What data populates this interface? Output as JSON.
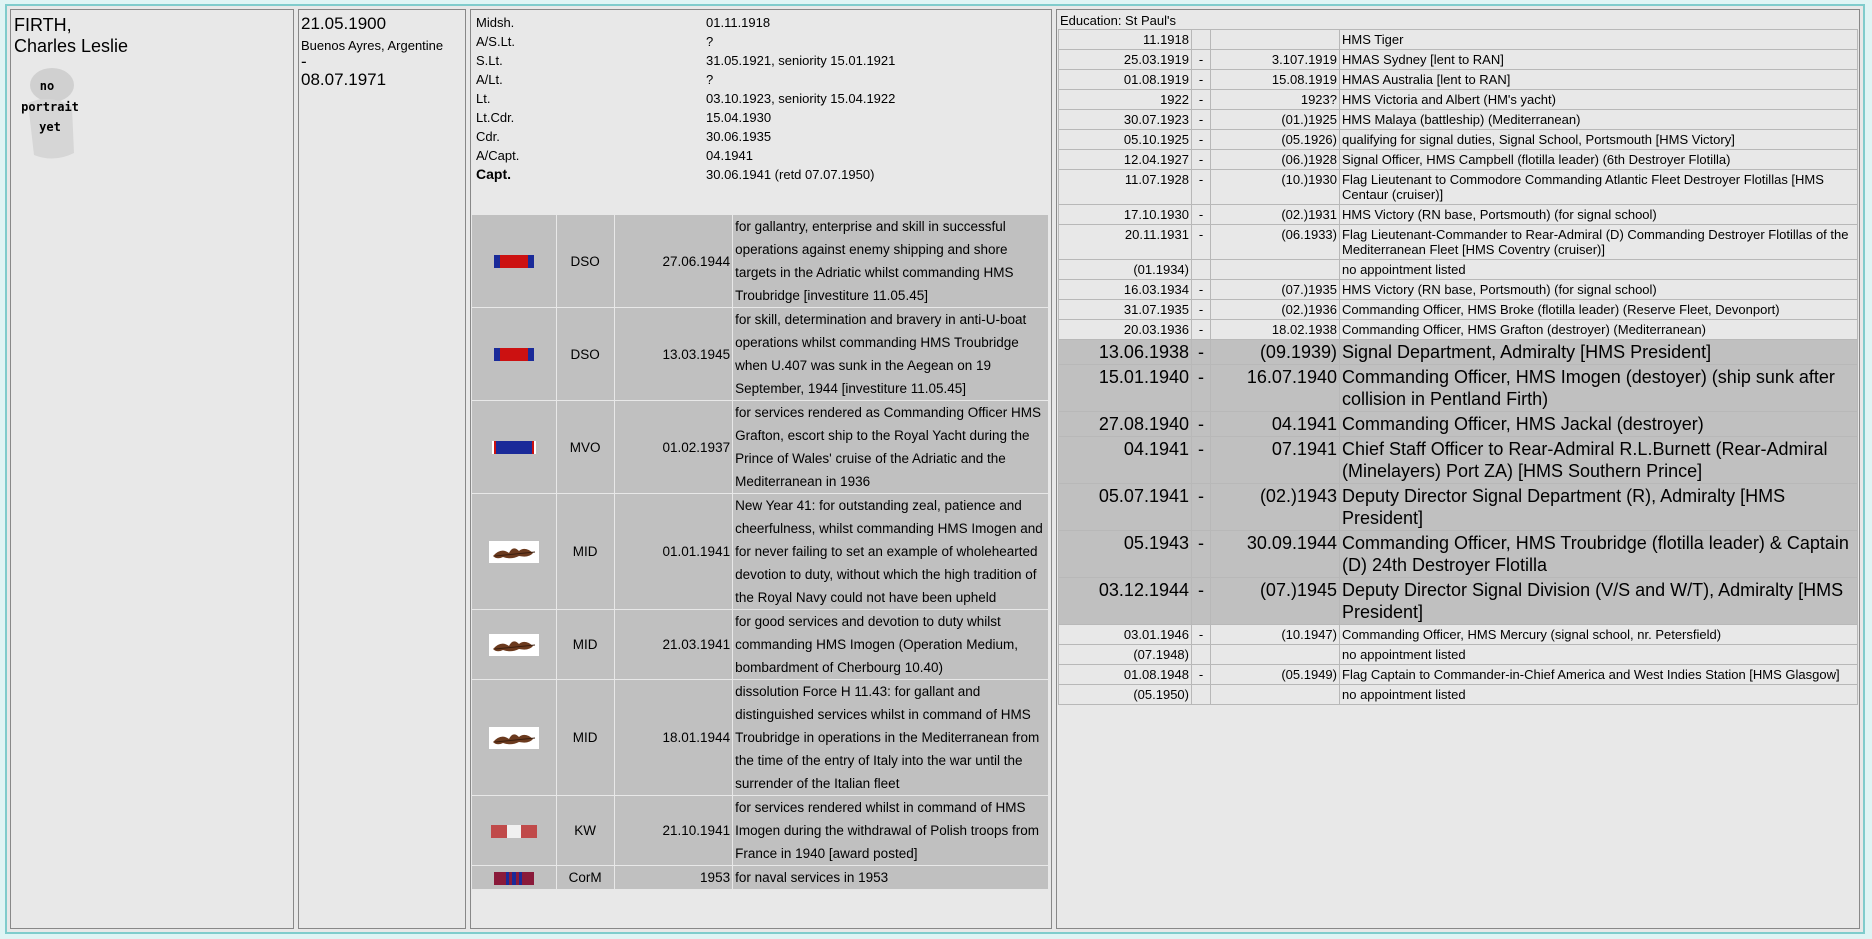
{
  "person": {
    "surname": "FIRTH,",
    "forenames": "Charles Leslie",
    "portrait_text": [
      "no",
      "portrait",
      "yet"
    ],
    "born": "21.05.1900",
    "birthplace": "Buenos Ayres, Argentine",
    "dash": "-",
    "died": "08.07.1971"
  },
  "ranks": [
    {
      "rank": "Midsh.",
      "date": "01.11.1918"
    },
    {
      "rank": "A/S.Lt.",
      "date": "?"
    },
    {
      "rank": "S.Lt.",
      "date": "31.05.1921, seniority 15.01.1921"
    },
    {
      "rank": "A/Lt.",
      "date": "?"
    },
    {
      "rank": "Lt.",
      "date": "03.10.1923, seniority 15.04.1922"
    },
    {
      "rank": "Lt.Cdr.",
      "date": "15.04.1930"
    },
    {
      "rank": "Cdr.",
      "date": "30.06.1935"
    },
    {
      "rank": "A/Capt.",
      "date": "04.1941"
    },
    {
      "rank": "Capt.",
      "date": "30.06.1941 (retd 07.07.1950)"
    }
  ],
  "awards": [
    {
      "ribbon": "dso-ribbon",
      "code": "DSO",
      "date": "27.06.1944",
      "citation": "for gallantry, enterprise and skill in successful operations against enemy shipping and shore targets in the Adriatic whilst commanding HMS Troubridge [investiture 11.05.45]"
    },
    {
      "ribbon": "dso-ribbon",
      "code": "DSO",
      "date": "13.03.1945",
      "citation": "for skill, determination and bravery in anti-U-boat operations whilst commanding HMS Troubridge when U.407 was sunk in the Aegean on 19 September, 1944 [investiture 11.05.45]"
    },
    {
      "ribbon": "mvo-ribbon",
      "code": "MVO",
      "date": "01.02.1937",
      "citation": "for services rendered as Commanding Officer HMS Grafton, escort ship to the Royal Yacht during the Prince of Wales' cruise of the Adriatic and the Mediterranean in 1936"
    },
    {
      "ribbon": "oak-leaf",
      "code": "MID",
      "date": "01.01.1941",
      "citation": "New Year 41: for outstanding zeal, patience and cheerfulness, whilst commanding HMS Imogen and for never failing to set an example of wholehearted devotion to duty, without which the high tradition of the Royal Navy could not have been upheld"
    },
    {
      "ribbon": "oak-leaf",
      "code": "MID",
      "date": "21.03.1941",
      "citation": "for good services and devotion to duty whilst commanding HMS Imogen (Operation Medium, bombardment of Cherbourg 10.40)"
    },
    {
      "ribbon": "oak-leaf",
      "code": "MID",
      "date": "18.01.1944",
      "citation": "dissolution Force H 11.43: for gallant and distinguished services whilst in command of HMS Troubridge in operations in the Mediterranean from the time of the entry of Italy into the war until the surrender of the Italian fleet"
    },
    {
      "ribbon": "kw-ribbon",
      "code": "KW",
      "date": "21.10.1941",
      "citation": "for services rendered whilst in command of HMS Imogen during the withdrawal of Polish troops from France in 1940 [award posted]"
    },
    {
      "ribbon": "corm-ribbon",
      "code": "CorM",
      "date": "1953",
      "citation": "for naval services in 1953"
    }
  ],
  "education": "Education: St Paul's",
  "career": [
    {
      "from": "11.1918",
      "dash": "",
      "to": "",
      "appt": "HMS Tiger",
      "hl": false
    },
    {
      "from": "25.03.1919",
      "dash": "-",
      "to": "3.107.1919",
      "appt": "HMAS Sydney [lent to RAN]",
      "hl": false
    },
    {
      "from": "01.08.1919",
      "dash": "-",
      "to": "15.08.1919",
      "appt": "HMAS Australia [lent to RAN]",
      "hl": false
    },
    {
      "from": "1922",
      "dash": "-",
      "to": "1923?",
      "appt": "HMS Victoria and Albert (HM's yacht)",
      "hl": false
    },
    {
      "from": "30.07.1923",
      "dash": "-",
      "to": "(01.)1925",
      "appt": "HMS Malaya (battleship) (Mediterranean)",
      "hl": false
    },
    {
      "from": "05.10.1925",
      "dash": "-",
      "to": "(05.1926)",
      "appt": "qualifying for signal duties, Signal School, Portsmouth [HMS Victory]",
      "hl": false
    },
    {
      "from": "12.04.1927",
      "dash": "-",
      "to": "(06.)1928",
      "appt": "Signal Officer, HMS Campbell (flotilla leader) (6th Destroyer Flotilla)",
      "hl": false
    },
    {
      "from": "11.07.1928",
      "dash": "-",
      "to": "(10.)1930",
      "appt": "Flag Lieutenant to Commodore Commanding Atlantic Fleet Destroyer Flotillas [HMS Centaur (cruiser)]",
      "hl": false
    },
    {
      "from": "17.10.1930",
      "dash": "-",
      "to": "(02.)1931",
      "appt": "HMS Victory (RN base, Portsmouth) (for signal school)",
      "hl": false
    },
    {
      "from": "20.11.1931",
      "dash": "-",
      "to": "(06.1933)",
      "appt": "Flag Lieutenant-Commander to Rear-Admiral (D) Commanding Destroyer Flotillas of the Mediterranean Fleet [HMS Coventry (cruiser)]",
      "hl": false
    },
    {
      "from": "(01.1934)",
      "dash": "",
      "to": "",
      "appt": "no appointment listed",
      "hl": false
    },
    {
      "from": "16.03.1934",
      "dash": "-",
      "to": "(07.)1935",
      "appt": "HMS Victory (RN base, Portsmouth) (for signal school)",
      "hl": false
    },
    {
      "from": "31.07.1935",
      "dash": "-",
      "to": "(02.)1936",
      "appt": "Commanding Officer, HMS Broke (flotilla leader) (Reserve Fleet, Devonport)",
      "hl": false
    },
    {
      "from": "20.03.1936",
      "dash": "-",
      "to": "18.02.1938",
      "appt": "Commanding Officer, HMS Grafton (destroyer) (Mediterranean)",
      "hl": false
    },
    {
      "from": "13.06.1938",
      "dash": "-",
      "to": "(09.1939)",
      "appt": "Signal Department, Admiralty [HMS President]",
      "hl": true
    },
    {
      "from": "15.01.1940",
      "dash": "-",
      "to": "16.07.1940",
      "appt": "Commanding Officer, HMS Imogen (destoyer) (ship sunk after collision in Pentland Firth)",
      "hl": true
    },
    {
      "from": "27.08.1940",
      "dash": "-",
      "to": "04.1941",
      "appt": "Commanding Officer, HMS Jackal (destroyer)",
      "hl": true
    },
    {
      "from": "04.1941",
      "dash": "-",
      "to": "07.1941",
      "appt": "Chief Staff Officer to Rear-Admiral R.L.Burnett (Rear-Admiral (Minelayers) Port ZA) [HMS Southern Prince]",
      "hl": true
    },
    {
      "from": "05.07.1941",
      "dash": "-",
      "to": "(02.)1943",
      "appt": "Deputy Director Signal Department (R), Admiralty [HMS President]",
      "hl": true
    },
    {
      "from": "05.1943",
      "dash": "-",
      "to": "30.09.1944",
      "appt": "Commanding Officer, HMS Troubridge (flotilla leader) & Captain (D) 24th Destroyer Flotilla",
      "hl": true
    },
    {
      "from": "03.12.1944",
      "dash": "-",
      "to": "(07.)1945",
      "appt": "Deputy Director Signal Division (V/S and W/T), Admiralty [HMS President]",
      "hl": true
    },
    {
      "from": "03.01.1946",
      "dash": "-",
      "to": "(10.1947)",
      "appt": "Commanding Officer, HMS Mercury (signal school, nr. Petersfield)",
      "hl": false
    },
    {
      "from": "(07.1948)",
      "dash": "",
      "to": "",
      "appt": "no appointment listed",
      "hl": false
    },
    {
      "from": "01.08.1948",
      "dash": "-",
      "to": "(05.1949)",
      "appt": "Flag Captain to Commander-in-Chief America and West Indies Station [HMS Glasgow]",
      "hl": false
    },
    {
      "from": "(05.1950)",
      "dash": "",
      "to": "",
      "appt": "no appointment listed",
      "hl": false
    }
  ]
}
